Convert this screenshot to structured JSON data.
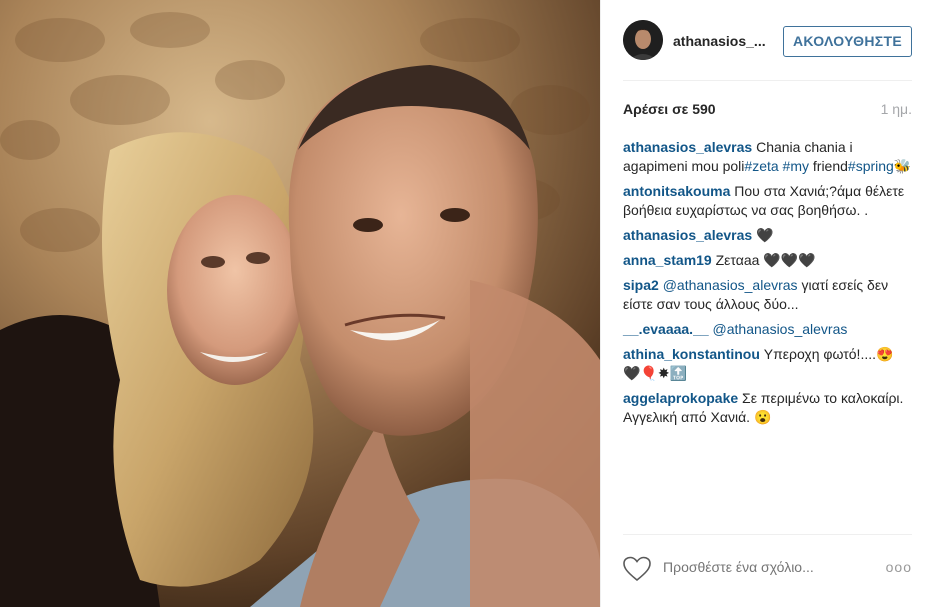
{
  "post": {
    "username": "athanasios_...",
    "follow_label": "ΑΚΟΛΟΥΘΗΣΤΕ",
    "likes": "Αρέσει σε 590",
    "time": "1 ημ.",
    "comment_placeholder": "Προσθέστε ένα σχόλιο...",
    "more_label": "ooo"
  },
  "comments": [
    {
      "author": "athanasios_alevras",
      "parts": [
        {
          "t": " Chania chania i agapimeni mou poli"
        },
        {
          "t": "#zeta",
          "tag": true
        },
        {
          "t": " "
        },
        {
          "t": "#my",
          "tag": true
        },
        {
          "t": " friend"
        },
        {
          "t": "#spring",
          "tag": true
        },
        {
          "t": "🐝"
        }
      ]
    },
    {
      "author": "antonitsakouma",
      "parts": [
        {
          "t": " Που στα Χανιά;?άμα θέλετε βοήθεια ευχαρίστως να σας βοηθήσω. ."
        }
      ]
    },
    {
      "author": "athanasios_alevras",
      "parts": [
        {
          "t": " 🖤"
        }
      ]
    },
    {
      "author": "anna_stam19",
      "parts": [
        {
          "t": " Ζεταaa 🖤🖤🖤"
        }
      ]
    },
    {
      "author": "sipa2",
      "parts": [
        {
          "t": " "
        },
        {
          "t": "@athanasios_alevras",
          "tag": true
        },
        {
          "t": " γιατί εσείς δεν είστε σαν τους άλλους δύο..."
        }
      ]
    },
    {
      "author": "__.evaaaa.__",
      "parts": [
        {
          "t": " "
        },
        {
          "t": "@athanasios_alevras",
          "tag": true
        }
      ]
    },
    {
      "author": "athina_konstantinou",
      "parts": [
        {
          "t": " Υπεροχη φωτό!....😍 🖤🎈✸🔝"
        }
      ]
    },
    {
      "author": "aggelaprokopake",
      "parts": [
        {
          "t": " Σε περιμένω το καλοκαίρι. Αγγελική από Χανιά. 😮"
        }
      ]
    }
  ]
}
